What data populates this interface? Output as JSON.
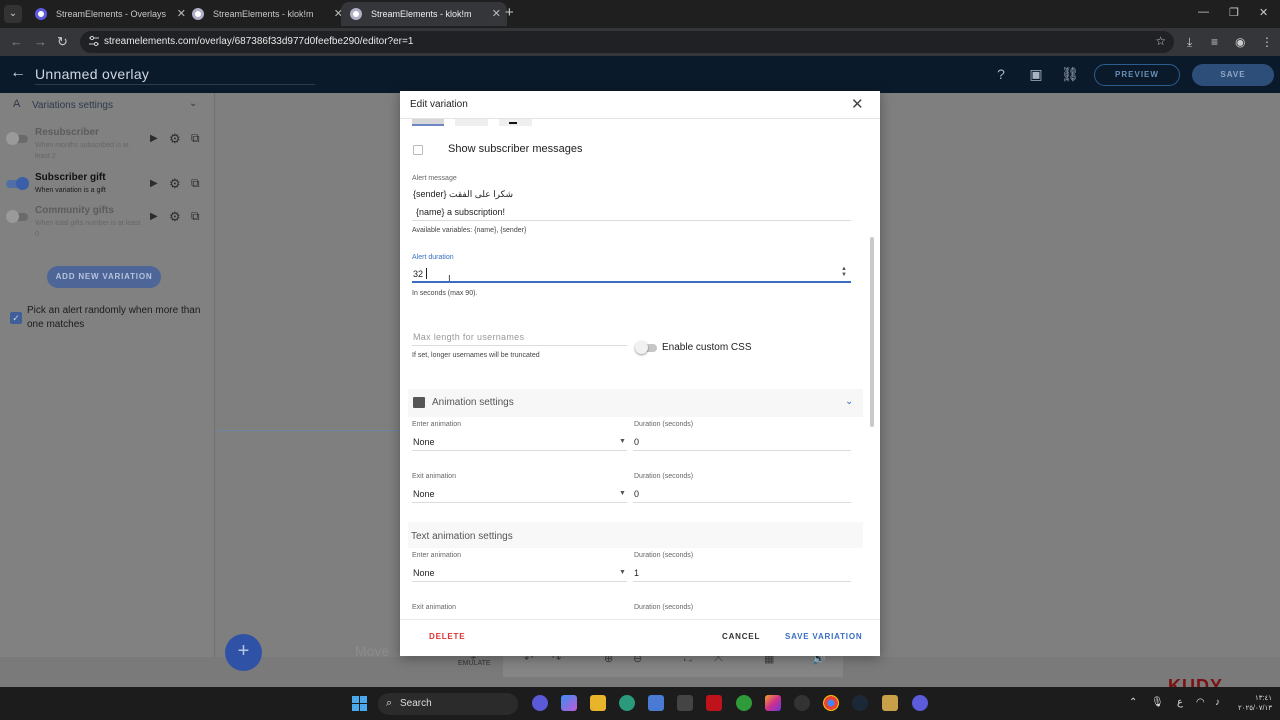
{
  "browser": {
    "tabs": [
      {
        "title": "StreamElements - Overlays"
      },
      {
        "title": "StreamElements - klok!m"
      },
      {
        "title": "StreamElements - klok!m"
      }
    ],
    "url": "streamelements.com/overlay/687386f33d977d0feefbe290/editor?er=1"
  },
  "header": {
    "title": "Unnamed overlay",
    "preview_label": "PREVIEW",
    "save_label": "SAVE"
  },
  "sidebar": {
    "section_title": "Variations settings",
    "variations": [
      {
        "name": "Resubscriber",
        "desc": "When months subscribed is at least 2",
        "enabled": false
      },
      {
        "name": "Subscriber gift",
        "desc": "When variation is a gift",
        "enabled": true
      },
      {
        "name": "Community gifts",
        "desc": "When total gifts number is at least 0",
        "enabled": false
      }
    ],
    "add_button": "ADD NEW VARIATION",
    "random_label": "Pick an alert randomly when more than one matches"
  },
  "canvas": {
    "move_text": "Move",
    "emulate_label": "EMULATE"
  },
  "modal": {
    "title": "Edit variation",
    "show_sub_messages": "Show subscriber messages",
    "alert_message_label": "Alert message",
    "alert_message_line1": "{sender} شكرا على الفقت",
    "alert_message_line2": "{name} a subscription!",
    "available_vars": "Available variables: {name}, {sender}",
    "alert_duration_label": "Alert duration",
    "alert_duration_value": "32",
    "duration_helper": "In seconds (max 90).",
    "max_length_placeholder": "Max length for usernames",
    "max_length_helper": "If set, longer usernames will be truncated",
    "custom_css_label": "Enable custom CSS",
    "animation_section": "Animation settings",
    "enter_animation_label": "Enter animation",
    "exit_animation_label": "Exit animation",
    "duration_seconds_label": "Duration (seconds)",
    "enter_animation_value": "None",
    "enter_duration_value": "0",
    "exit_animation_value": "None",
    "exit_duration_value": "0",
    "text_animation_section": "Text animation settings",
    "text_enter_value": "None",
    "text_enter_duration": "1",
    "delete_label": "DELETE",
    "cancel_label": "CANCEL",
    "save_variation_label": "SAVE VARIATION"
  },
  "taskbar": {
    "search_label": "Search",
    "clock_time": "١٣:٤١",
    "clock_date": "٢٠٢٥/٠٧/١٣",
    "tray_lang": "ع"
  },
  "overlay_watermark": "KUDY",
  "colors": {
    "accent_blue": "#3a6ec4",
    "danger_red": "#dd3333",
    "header_bg": "#0b1a2b"
  }
}
